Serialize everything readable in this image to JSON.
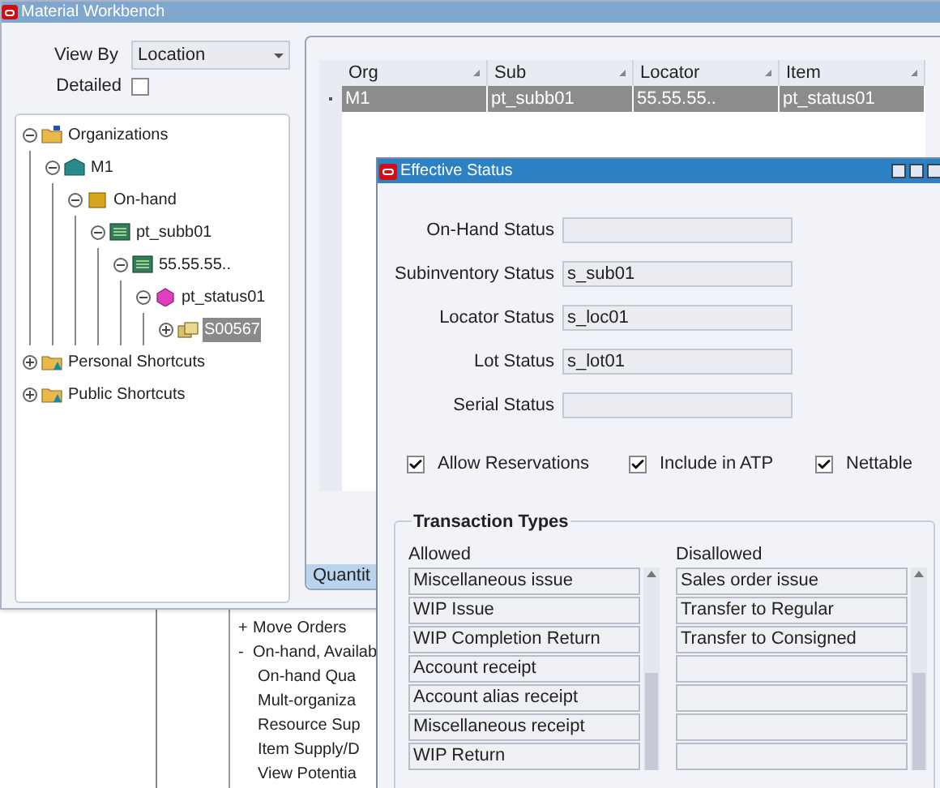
{
  "main_window": {
    "title": "Material Workbench",
    "view_by": {
      "label": "View By",
      "value": "Location"
    },
    "detailed": {
      "label": "Detailed",
      "checked": false
    },
    "tree": [
      {
        "label": "Organizations",
        "kind": "folder",
        "expanded": true,
        "selected": false,
        "children": [
          {
            "label": "M1",
            "kind": "org",
            "expanded": true,
            "selected": false,
            "children": [
              {
                "label": "On-hand",
                "kind": "onhand",
                "expanded": true,
                "selected": false,
                "children": [
                  {
                    "label": "pt_subb01",
                    "kind": "subinventory",
                    "expanded": true,
                    "selected": false,
                    "children": [
                      {
                        "label": "55.55.55..",
                        "kind": "subinventory",
                        "expanded": true,
                        "selected": false,
                        "children": [
                          {
                            "label": "pt_status01",
                            "kind": "item",
                            "expanded": true,
                            "selected": false,
                            "children": [
                              {
                                "label": "S00567",
                                "kind": "lot",
                                "expanded": false,
                                "selected": true
                              }
                            ]
                          }
                        ]
                      }
                    ]
                  }
                ]
              }
            ]
          }
        ]
      },
      {
        "label": "Personal Shortcuts",
        "kind": "shortcut",
        "expanded": false,
        "selected": false
      },
      {
        "label": "Public Shortcuts",
        "kind": "shortcut",
        "expanded": false,
        "selected": false
      }
    ],
    "grid": {
      "columns": [
        "Org",
        "Sub",
        "Locator",
        "Item"
      ],
      "rows": [
        {
          "cells": [
            "M1",
            "pt_subb01",
            "55.55.55..",
            "pt_status01"
          ],
          "selected": true
        }
      ]
    },
    "tabs": [
      {
        "label": "Quantit",
        "selected": true
      }
    ]
  },
  "navigator": {
    "items": [
      {
        "label": "Move Orders",
        "marker": "+"
      },
      {
        "label": "On-hand, Availab",
        "marker": "-",
        "children": [
          {
            "label": "On-hand Qua"
          },
          {
            "label": "Mult-organiza"
          },
          {
            "label": "Resource Sup"
          },
          {
            "label": "Item Supply/D"
          },
          {
            "label": "View Potentia"
          }
        ]
      }
    ]
  },
  "dialog": {
    "title": "Effective Status",
    "fields": [
      {
        "label": "On-Hand Status"
      },
      {
        "label": "Subinventory Status",
        "value": "s_sub01"
      },
      {
        "label": "Locator Status",
        "value": "s_loc01"
      },
      {
        "label": "Lot Status",
        "value": "s_lot01"
      },
      {
        "label": "Serial Status"
      }
    ],
    "options": [
      {
        "label": "Allow Reservations",
        "checked": true
      },
      {
        "label": "Include in ATP",
        "checked": true
      },
      {
        "label": "Nettable",
        "checked": true
      }
    ],
    "transaction_types": {
      "title": "Transaction Types",
      "allowed": {
        "label": "Allowed",
        "items": [
          "Miscellaneous issue",
          "WIP Issue",
          "WIP Completion Return",
          "Account receipt",
          "Account alias receipt",
          "Miscellaneous receipt",
          "WIP Return"
        ]
      },
      "disallowed": {
        "label": "Disallowed",
        "items": [
          "Sales order issue",
          "Transfer to Regular",
          "Transfer to Consigned"
        ]
      }
    }
  }
}
